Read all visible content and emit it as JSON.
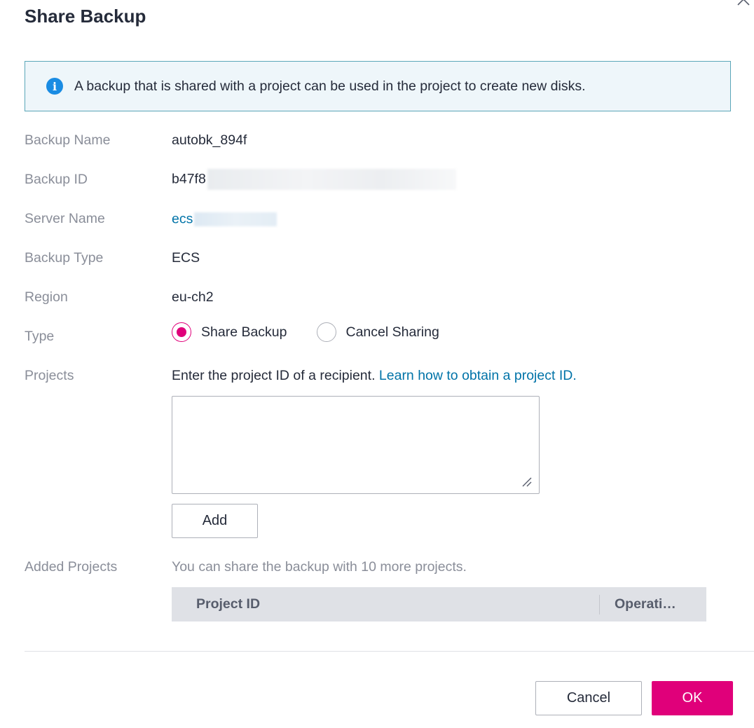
{
  "dialog": {
    "title": "Share Backup"
  },
  "info": {
    "icon": "info-icon",
    "glyph": "i",
    "text": "A backup that is shared with a project can be used in the project to create new disks."
  },
  "fields": {
    "backup_name_label": "Backup Name",
    "backup_name_value": "autobk_894f",
    "backup_id_label": "Backup ID",
    "backup_id_value": "b47f8",
    "server_name_label": "Server Name",
    "server_name_value": "ecs",
    "backup_type_label": "Backup Type",
    "backup_type_value": "ECS",
    "region_label": "Region",
    "region_value": "eu-ch2",
    "type_label": "Type",
    "projects_label": "Projects",
    "added_projects_label": "Added Projects"
  },
  "type_options": {
    "share_label": "Share Backup",
    "cancel_label": "Cancel Sharing",
    "selected": "Share Backup"
  },
  "projects": {
    "instruction": "Enter the project ID of a recipient.",
    "learn_link": "Learn how to obtain a project ID.",
    "textarea_value": "",
    "add_label": "Add"
  },
  "added_projects": {
    "hint": "You can share the backup with 10 more projects.",
    "columns": [
      "Project ID",
      "Operati…"
    ],
    "rows": []
  },
  "footer": {
    "cancel_label": "Cancel",
    "ok_label": "OK"
  },
  "colors": {
    "accent": "#e0007a",
    "link": "#0073a8",
    "info_icon": "#1a8ce3"
  }
}
